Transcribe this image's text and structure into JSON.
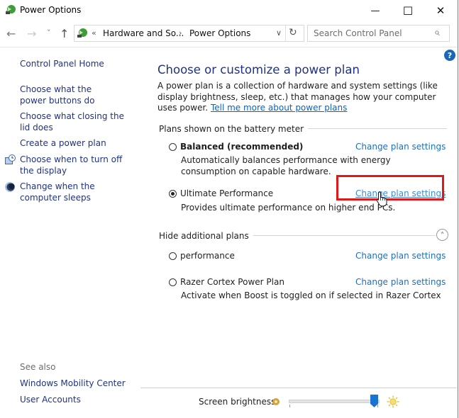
{
  "window": {
    "title": "Power Options",
    "minimize_label": "—",
    "maximize_label": "☐",
    "close_label": "✕"
  },
  "nav": {
    "back_icon": "←",
    "forward_icon": "→",
    "recent_icon": "˅",
    "up_icon": "↑",
    "breadcrumb": {
      "overflow": "«",
      "items": [
        "Hardware and So...",
        "Power Options"
      ],
      "separator": "›"
    },
    "dropdown_icon": "∨",
    "refresh_icon": "↻",
    "search": {
      "placeholder": "Search Control Panel",
      "value": "",
      "icon": "⌕"
    }
  },
  "sidebar": {
    "home": "Control Panel Home",
    "tasks": [
      {
        "label": "Choose what the power buttons do",
        "icon": ""
      },
      {
        "label": "Choose what closing the lid does",
        "icon": ""
      },
      {
        "label": "Create a power plan",
        "icon": ""
      },
      {
        "label": "Choose when to turn off the display",
        "icon": "display-clock-icon"
      },
      {
        "label": "Change when the computer sleeps",
        "icon": "moon-sleep-icon"
      }
    ],
    "see_also_label": "See also",
    "see_also": [
      "Windows Mobility Center",
      "User Accounts"
    ]
  },
  "main": {
    "help_label": "?",
    "heading": "Choose or customize a power plan",
    "description": "A power plan is a collection of hardware and system settings (like display brightness, sleep, etc.) that manages how your computer uses power. ",
    "description_link": "Tell me more about power plans",
    "battery_group_label": "Plans shown on the battery meter",
    "battery_plans": [
      {
        "name": "Balanced (recommended)",
        "bold": true,
        "selected": false,
        "description": "Automatically balances performance with energy consumption on capable hardware.",
        "link": "Change plan settings"
      },
      {
        "name": "Ultimate Performance",
        "bold": false,
        "selected": true,
        "description": "Provides ultimate performance on higher end PCs.",
        "link": "Change plan settings"
      }
    ],
    "additional_group_label": "Hide additional plans",
    "collapse_icon": "˄",
    "additional_plans": [
      {
        "name": "performance",
        "selected": false,
        "description": "",
        "link": "Change plan settings"
      },
      {
        "name": "Razer Cortex Power Plan",
        "selected": false,
        "description": "Activate when Boost is toggled on if selected in Razer Cortex",
        "link": "Change plan settings"
      }
    ]
  },
  "footer": {
    "brightness_label": "Screen brightness:",
    "brightness_value_percent": 96,
    "min_icon": "dim-sun-icon",
    "max_icon": "bright-sun-icon"
  },
  "annotation": {
    "highlight_color": "#e01818",
    "highlighted_element": "Ultimate Performance - Change plan settings"
  }
}
